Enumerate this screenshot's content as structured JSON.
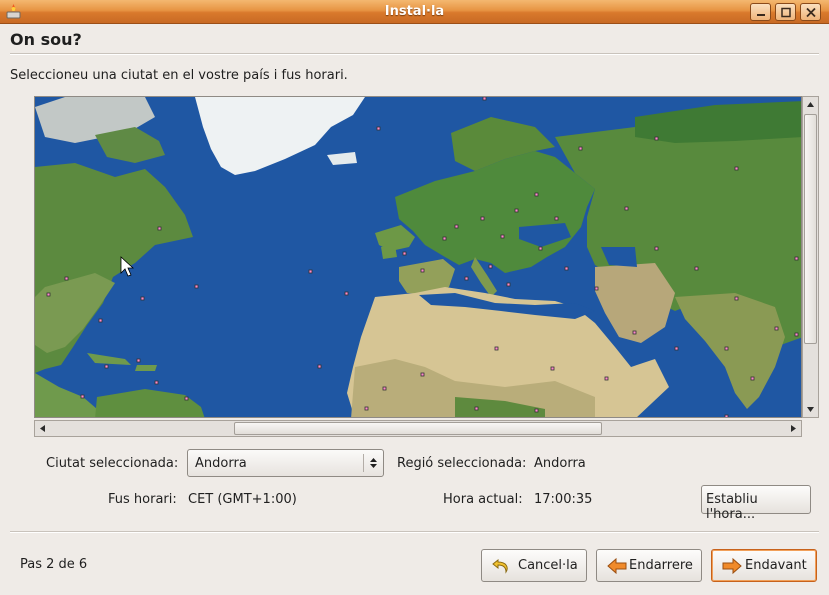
{
  "window": {
    "title": "Instal·la"
  },
  "page": {
    "heading": "On sou?",
    "instruction": "Seleccioneu una ciutat en el vostre país i fus horari."
  },
  "location": {
    "city_label": "Ciutat seleccionada:",
    "city_value": "Andorra",
    "region_label": "Regió seleccionada:",
    "region_value": "Andorra",
    "timezone_label": "Fus horari:",
    "timezone_value": "CET (GMT+1:00)",
    "time_label": "Hora actual:",
    "time_value": "17:00:35",
    "set_time_button": "Establiu l'hora..."
  },
  "footer": {
    "step": "Pas 2 de 6",
    "cancel": "Cancel·la",
    "back": "Endarrere",
    "forward": "Endavant"
  },
  "colors": {
    "titlebar": "#e08a3a",
    "ocean": "#1f57a3",
    "city_dot": "#ff88cc"
  }
}
